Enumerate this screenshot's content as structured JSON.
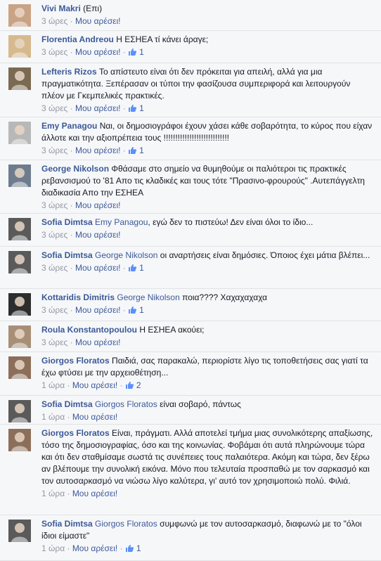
{
  "comments": [
    {
      "author": "Vivi Makri",
      "tag": "",
      "text": "(Επι)",
      "time": "3 ώρες",
      "like": "Μου αρέσει!",
      "likes": ""
    },
    {
      "author": "Florentia Andreou",
      "tag": "",
      "text": "Η ΕΣΗΕΑ τί κάνει άραγε;",
      "time": "3 ώρες",
      "like": "Μου αρέσει!",
      "likes": "1"
    },
    {
      "author": "Lefteris Rizos",
      "tag": "",
      "text": "Το απίστευτο είναι ότι δεν πρόκειται για απειλή, αλλά για μια πραγματικότητα. Ξεπέρασαν οι τύποι την φασίζουσα συμπεριφορά και λειτουργούν πλέον με Γκεμπελικές πρακτικές.",
      "time": "3 ώρες",
      "like": "Μου αρέσει!",
      "likes": "1"
    },
    {
      "author": "Emy Panagou",
      "tag": "",
      "text": "Ναι, οι δημοσιογράφοι έχουν χάσει κάθε σοβαρότητα, το κύρος που είχαν άλλοτε και την αξιοπρέπεια τους !!!!!!!!!!!!!!!!!!!!!!!!!!!!",
      "time": "3 ώρες",
      "like": "Μου αρέσει!",
      "likes": "1"
    },
    {
      "author": "George Nikolson",
      "tag": "",
      "text": "Φθάσαμε στο σημείο να θυμηθούμε οι παλιότεροι τις πρακτικές ρεβανσισμού το '81 Απο τις κλαδικές και τους τότε \"Πρασινο-φρουρούς\" .Αυτεπάγγελτη διαδικασία Απο την ΕΣΗΕΑ",
      "time": "3 ώρες",
      "like": "Μου αρέσει!",
      "likes": ""
    },
    {
      "author": "Sofia Dimtsa",
      "tag": "Emy Panagou",
      "text": ", εγώ δεν το πιστεύω! Δεν είναι όλοι το ίδιο...",
      "time": "3 ώρες",
      "like": "Μου αρέσει!",
      "likes": ""
    },
    {
      "author": "Sofia Dimtsa",
      "tag": "George Nikolson",
      "text": "οι αναρτήσεις είναι δημόσιες. Όποιος έχει μάτια βλέπει...",
      "time": "3 ώρες",
      "like": "Μου αρέσει!",
      "likes": "1"
    },
    {
      "author": "Kottaridis Dimitris",
      "tag": "George Nikolson",
      "text": "ποια???? Χαχαχαχαχα",
      "time": "3 ώρες",
      "like": "Μου αρέσει!",
      "likes": "1"
    },
    {
      "author": "Roula Konstantopoulou",
      "tag": "",
      "text": "Η ΕΣΗΕΑ ακούει;",
      "time": "3 ώρες",
      "like": "Μου αρέσει!",
      "likes": ""
    },
    {
      "author": "Giorgos Floratos",
      "tag": "",
      "text": "Παιδιά, σας παρακαλώ, περιορίστε λίγο τις τοποθετήσεις σας γιατί τα έχω φτύσει με την αρχειοθέτηση...",
      "time": "1 ώρα",
      "like": "Μου αρέσει!",
      "likes": "2"
    },
    {
      "author": "Sofia Dimtsa",
      "tag": "Giorgos Floratos",
      "text": "είναι σοβαρό, πάντως",
      "time": "1 ώρα",
      "like": "Μου αρέσει!",
      "likes": ""
    },
    {
      "author": "Giorgos Floratos",
      "tag": "",
      "text": "Είναι, πράγματι. Αλλά αποτελεί τμήμα μιας συνολικότερης απαξίωσης, τόσο της δημοσιογραφίας, όσο και της κοινωνίας. Φοβάμαι ότι αυτά πληρώνουμε τώρα και ότι δεν σταθμίσαμε σωστά τις συνέπειες τους παλαιότερα. Ακόμη και τώρα, δεν ξέρω αν βλέπουμε την συνολική εικόνα. Μόνο που τελευταία προσπαθώ με τον σαρκασμό και τον αυτοσαρκασμό να νιώσω λίγο καλύτερα, γι' αυτό τον χρησιμοποιώ πολύ. Φιλιά.",
      "time": "1 ώρα",
      "like": "Μου αρέσει!",
      "likes": ""
    },
    {
      "author": "Sofia Dimtsa",
      "tag": "Giorgos Floratos",
      "text": "συμφωνώ με τον αυτοσαρκασμό, διαφωνώ με το \"όλοι ίδιοι είμαστε\"",
      "time": "1 ώρα",
      "like": "Μου αρέσει!",
      "likes": "1"
    }
  ],
  "colors": {
    "link": "#3b5998",
    "meta": "#9197a3",
    "text": "#141823",
    "divider": "#e1e2e3",
    "background": "#f6f7f9"
  },
  "icons": {
    "like_count": "thumbs-up-icon",
    "avatar": "avatar-photo"
  }
}
